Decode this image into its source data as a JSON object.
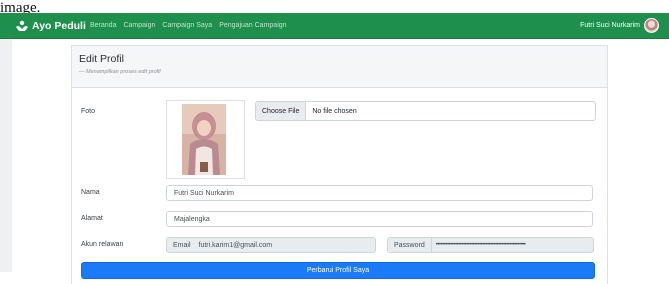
{
  "caption": "image.",
  "navbar": {
    "brand": "Ayo Peduli",
    "links": [
      "Beranda",
      "Campaign",
      "Campaign Saya",
      "Pengajuan Campaign"
    ],
    "user_name": "Futri Suci Nurkarim"
  },
  "card": {
    "title": "Edit Profil",
    "subtitle": "— Menampilkan proses edit profil"
  },
  "form": {
    "photo_label": "Foto",
    "file_button": "Choose File",
    "file_status": "No file chosen",
    "name_label": "Nama",
    "name_value": "Futri Suci Nurkarim",
    "address_label": "Alamat",
    "address_value": "Majalengka",
    "account_label": "Akun relawan",
    "email_addon": "Email",
    "email_value": "futri.karim1@gmail.com",
    "password_addon": "Password",
    "password_value": "••••••••••••••••••••••••••••••••••••••••••••••••••••••••",
    "submit_label": "Perbarui Profil Saya"
  },
  "colors": {
    "navbar": "#1e8f4c",
    "primary_button": "#1a7af8"
  }
}
